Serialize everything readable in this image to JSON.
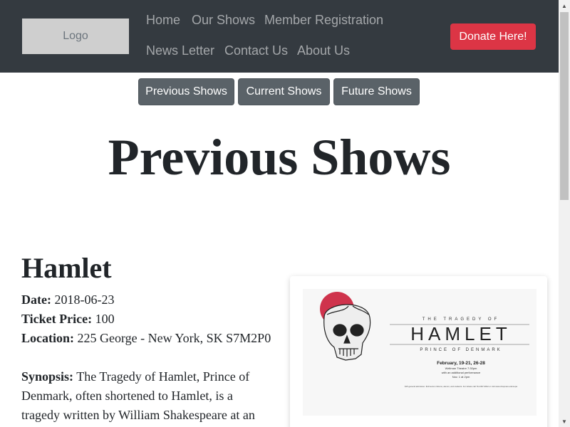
{
  "navbar": {
    "logo": "Logo",
    "links": [
      "Home",
      "Our Shows",
      "Member Registration",
      "News Letter",
      "Contact Us",
      "About Us"
    ],
    "donate": "Donate Here!"
  },
  "tabs": [
    "Previous Shows",
    "Current Shows",
    "Future Shows"
  ],
  "page_title": "Previous Shows",
  "show": {
    "title": "Hamlet",
    "date_label": "Date:",
    "date": "2018-06-23",
    "price_label": "Ticket Price:",
    "price": "100",
    "location_label": "Location:",
    "location": "225 George - New York, SK S7M2P0",
    "synopsis_label": "Synopsis:",
    "synopsis": "The Tragedy of Hamlet, Prince of Denmark, often shortened to Hamlet, is a tragedy written by William Shakespeare at an uncertain"
  },
  "poster": {
    "line1": "THE TRAGEDY OF",
    "title": "HAMLET",
    "subtitle": "PRINCE OF DENMARK",
    "dates": "February, 19-21, 26-28",
    "venue": "Wellman Theatre 7:30pm",
    "extra": "with an additional performance",
    "extra2": "Nov. 1 at 2pm",
    "fineprint": "$15 general admission. $10 senior citizens, alumni, and students. For tickets call 714-997-6812 or visit www.chapman.edu/cepa"
  },
  "colors": {
    "navbar": "#343a40",
    "donate": "#dc3545",
    "tab": "#5a6268",
    "poster_accent": "#c8102e"
  }
}
